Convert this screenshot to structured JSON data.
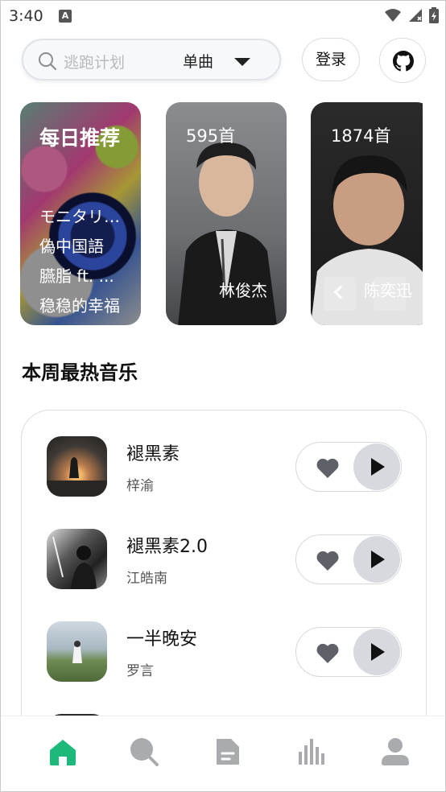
{
  "status_bar": {
    "time": "3:40",
    "notification_icon_letter": "A"
  },
  "search": {
    "placeholder": "逃跑计划",
    "type_label": "单曲"
  },
  "header": {
    "login_label": "登录",
    "github_icon": "github-icon"
  },
  "cards": {
    "daily": {
      "title": "每日推荐",
      "songs": [
        "モニタリング",
        "偽中国語",
        "臙脂 ft. ...",
        "稳稳的幸福"
      ]
    },
    "artists": [
      {
        "count": "595首",
        "name": "林俊杰"
      },
      {
        "count": "1874首",
        "name": "陈奕迅"
      }
    ]
  },
  "section": {
    "title": "本周最热音乐"
  },
  "tracks": [
    {
      "title": "褪黑素",
      "artist": "梓渝"
    },
    {
      "title": "褪黑素2.0",
      "artist": "江皓南"
    },
    {
      "title": "一半晚安",
      "artist": "罗言"
    }
  ],
  "nav": {
    "active_color": "#1db97a",
    "inactive_color": "#a9abae",
    "items": [
      "home-icon",
      "search-icon",
      "document-icon",
      "chart-icon",
      "user-icon"
    ]
  }
}
